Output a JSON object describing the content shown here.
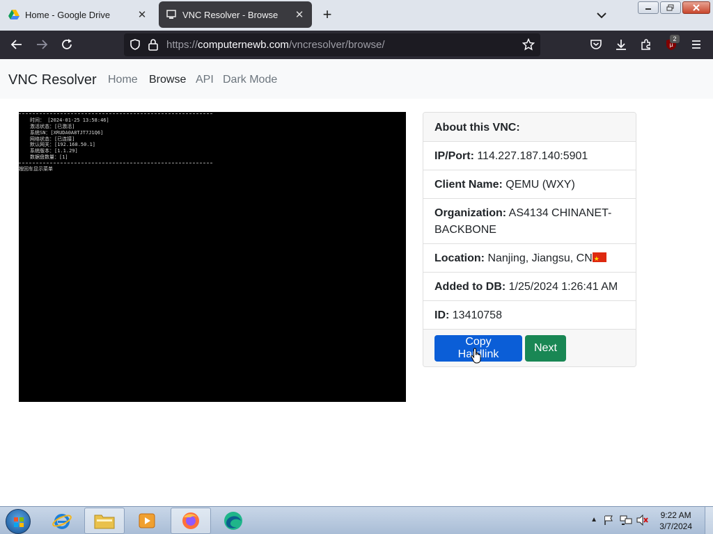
{
  "browser": {
    "tabs": [
      {
        "title": "Home - Google Drive",
        "active": false
      },
      {
        "title": "VNC Resolver - Browse",
        "active": true
      }
    ],
    "url_prefix": "https://",
    "url_host": "computernewb.com",
    "url_path": "/vncresolver/browse/",
    "extension_badge": "2"
  },
  "site": {
    "brand": "VNC Resolver",
    "nav": [
      "Home",
      "Browse",
      "API",
      "Dark Mode"
    ]
  },
  "vnc_screen": {
    "lines": [
      "时间：     [2024-01-25 13:58:46]",
      "激活状态：[已激活]",
      "系统SN：[XRUDA0A8TJT7J1Q6]",
      "网络状态：[已连接]",
      "默认网关：[192.168.50.1]",
      "系统版本：[1.1.29]",
      "数据盘数量：[1]"
    ],
    "menu_hint": "按回车显示菜单"
  },
  "card": {
    "header": "About this VNC:",
    "ip_label": "IP/Port:",
    "ip_value": "114.227.187.140:5901",
    "client_label": "Client Name:",
    "client_value": "QEMU (WXY)",
    "org_label": "Organization:",
    "org_value": "AS4134 CHINANET-BACKBONE",
    "location_label": "Location:",
    "location_value": "Nanjing, Jiangsu, CN",
    "added_label": "Added to DB:",
    "added_value": "1/25/2024 1:26:41 AM",
    "id_label": "ID:",
    "id_value": "13410758",
    "copy_button": "Copy Hardlink",
    "next_button": "Next"
  },
  "taskbar": {
    "time": "9:22 AM",
    "date": "3/7/2024"
  }
}
